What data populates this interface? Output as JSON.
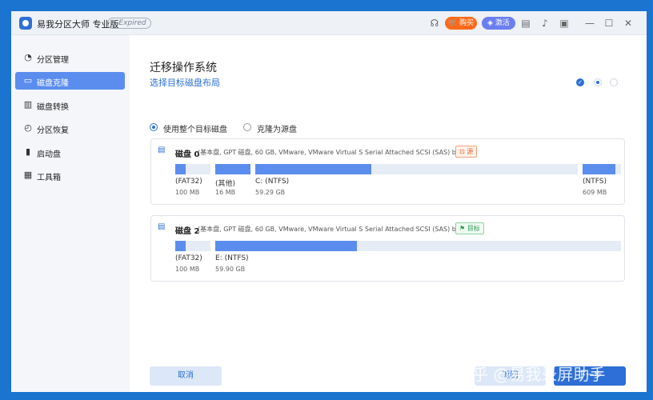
{
  "titlebar": {
    "app_title": "易我分区大师 专业版",
    "expired_badge": "Expired",
    "buy_label": "购买",
    "activate_label": "激活"
  },
  "sidebar": {
    "items": [
      {
        "label": "分区管理",
        "icon": "partition-icon",
        "active": false
      },
      {
        "label": "磁盘克隆",
        "icon": "clone-icon",
        "active": true
      },
      {
        "label": "磁盘转换",
        "icon": "convert-icon",
        "active": false
      },
      {
        "label": "分区恢复",
        "icon": "recovery-icon",
        "active": false
      },
      {
        "label": "启动盘",
        "icon": "boot-icon",
        "active": false
      },
      {
        "label": "工具箱",
        "icon": "toolbox-icon",
        "active": false
      }
    ]
  },
  "main": {
    "title": "迁移操作系统",
    "subtitle": "选择目标磁盘布局",
    "options": [
      {
        "label": "使用整个目标磁盘",
        "checked": true
      },
      {
        "label": "克隆为源盘",
        "checked": false
      }
    ],
    "disks": [
      {
        "name": "磁盘 0",
        "desc": "(基本盘, GPT 磁盘, 60 GB, VMware,  VMware Virtual S Serial Attached SCSI (SAS) bus)",
        "tag": "源",
        "partitions": [
          {
            "label": "(FAT32)",
            "size": "100 MB",
            "fill": 0.3
          },
          {
            "label": "(其他)",
            "size": "16 MB",
            "fill": 1.0
          },
          {
            "label": "C: (NTFS)",
            "size": "59.29 GB",
            "fill": 0.36
          },
          {
            "label": "(NTFS)",
            "size": "609 MB",
            "fill": 0.85
          }
        ]
      },
      {
        "name": "磁盘 2",
        "desc": "(基本盘, GPT 磁盘, 60 GB, VMware,  VMware Virtual S Serial Attached SCSI (SAS) bus)",
        "tag": "目标",
        "partitions": [
          {
            "label": "(FAT32)",
            "size": "100 MB",
            "fill": 0.3
          },
          {
            "label": "E: (NTFS)",
            "size": "59.90 GB",
            "fill": 0.35
          }
        ]
      }
    ]
  },
  "footer": {
    "cancel_label": "取消",
    "back_label": "返回",
    "next_label": "下一步"
  },
  "watermark": "知乎 @易我录屏助手",
  "colors": {
    "accent": "#2d6fd6",
    "sidebar_active": "#5b8dee",
    "buy": "#ff6a1a",
    "activate": "#6b7ef0"
  }
}
